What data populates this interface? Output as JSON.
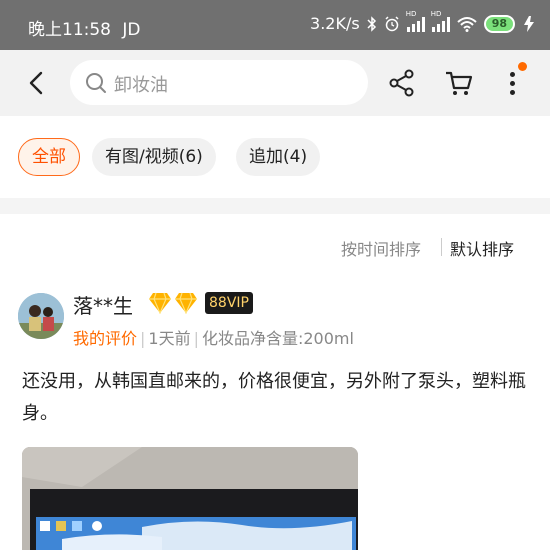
{
  "status_bar": {
    "time": "晚上11:58",
    "carrier": "JD",
    "speed": "3.2K/s",
    "signal_1_label": "HD",
    "signal_2_label": "HD",
    "battery": "98"
  },
  "nav": {
    "search_placeholder": "卸妆油"
  },
  "filters": {
    "all": "全部",
    "with_media": "有图/视频(6)",
    "followup": "追加(4)"
  },
  "sort": {
    "by_time": "按时间排序",
    "default": "默认排序"
  },
  "review": {
    "username": "落**生",
    "vip_badge": "88VIP",
    "my_review": "我的评价",
    "time_ago": "1天前",
    "spec": "化妆品净含量:200ml",
    "text": "还没用，从韩国直邮来的，价格很便宜，另外附了泵头，塑料瓶身。"
  },
  "colors": {
    "accent": "#ff5000",
    "status_bar": "#707070",
    "nav_bg": "#f2f2f2"
  }
}
